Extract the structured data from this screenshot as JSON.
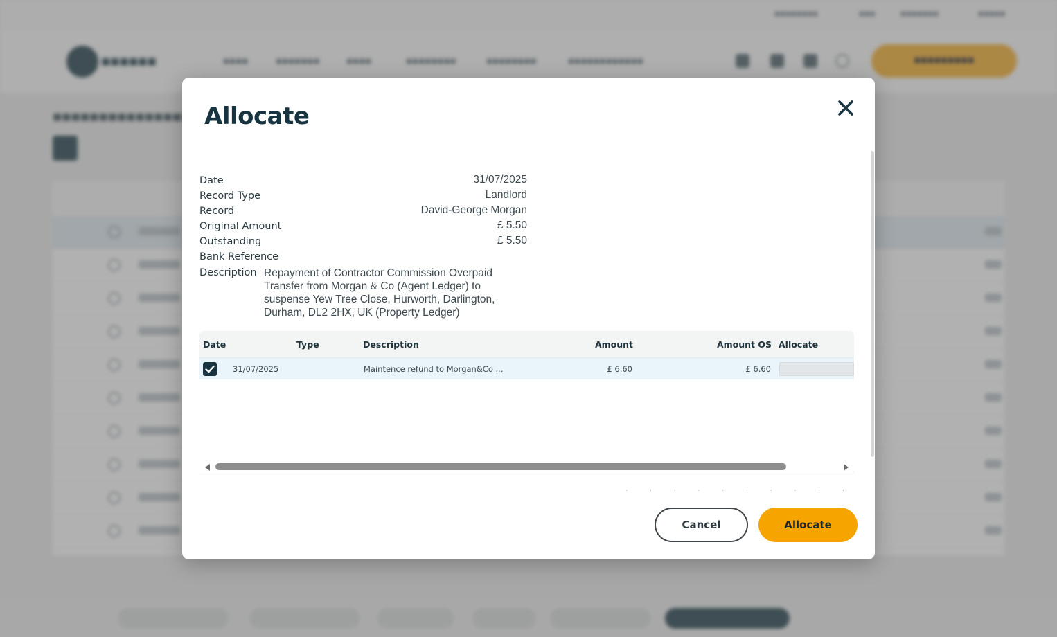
{
  "modal": {
    "title": "Allocate",
    "fields": [
      {
        "label": "Date",
        "value": "31/07/2025"
      },
      {
        "label": "Record Type",
        "value": "Landlord"
      },
      {
        "label": "Record",
        "value": "David-George Morgan"
      },
      {
        "label": "Original Amount",
        "value": "£ 5.50"
      },
      {
        "label": "Outstanding",
        "value": "£ 5.50"
      },
      {
        "label": "Bank Reference",
        "value": ""
      }
    ],
    "description": {
      "label": "Description",
      "value": "Repayment of Contractor Commission Overpaid Transfer from Morgan & Co (Agent Ledger) to suspense Yew Tree Close, Hurworth, Darlington, Durham, DL2 2HX, UK (Property Ledger)"
    },
    "table": {
      "headers": [
        "Date",
        "Type",
        "Description",
        "Amount",
        "Amount OS",
        "Allocate"
      ],
      "rows": [
        {
          "checked": true,
          "date": "31/07/2025",
          "type": "",
          "description": "Maintence refund to Morgan&Co ...",
          "amount": "£ 6.60",
          "amount_os": "£ 6.60",
          "allocate": ""
        }
      ]
    },
    "buttons": {
      "cancel": "Cancel",
      "allocate": "Allocate"
    }
  },
  "colors": {
    "primary": "#173440",
    "accent": "#f6a500",
    "row_highlight": "#eaf5fb"
  }
}
